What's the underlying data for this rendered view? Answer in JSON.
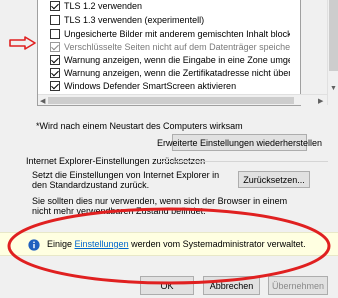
{
  "settings": {
    "options": [
      {
        "label": "TLS 1.2 verwenden",
        "checked": true,
        "grayed": false
      },
      {
        "label": "TLS 1.3 verwenden (experimentell)",
        "checked": false,
        "grayed": false
      },
      {
        "label": "Ungesicherte Bilder mit anderem gemischten Inhalt blockie",
        "checked": false,
        "grayed": false
      },
      {
        "label": "Verschlüsselte Seiten nicht auf dem Datenträger speicherr",
        "checked": true,
        "grayed": true
      },
      {
        "label": "Warnung anzeigen, wenn die Eingabe in eine Zone umgele",
        "checked": true,
        "grayed": false
      },
      {
        "label": "Warnung anzeigen, wenn die Zertifikatadresse nicht überi",
        "checked": true,
        "grayed": false
      },
      {
        "label": "Windows Defender SmartScreen aktivieren",
        "checked": true,
        "grayed": false
      }
    ]
  },
  "restart_note": "*Wird nach einem Neustart des Computers wirksam",
  "advanced_reset_label": "Erweiterte Einstellungen wiederherstellen",
  "reset_group": {
    "title": "Internet Explorer-Einstellungen zurücksetzen",
    "description": "Setzt die Einstellungen von Internet Explorer in den Standardzustand zurück.",
    "button_label": "Zurücksetzen...",
    "warning": "Sie sollten dies nur verwenden, wenn sich der Browser in einem nicht mehr verwendbaren Zustand befindet."
  },
  "policy": {
    "prefix": "Einige ",
    "link": "Einstellungen",
    "suffix": " werden vom Systemadministrator verwaltet."
  },
  "buttons": {
    "ok": "OK",
    "cancel": "Abbrechen",
    "apply": "Übernehmen"
  },
  "colors": {
    "annotation_red": "#e02020",
    "info_icon": "#1f5fbf",
    "link": "#0066cc"
  }
}
